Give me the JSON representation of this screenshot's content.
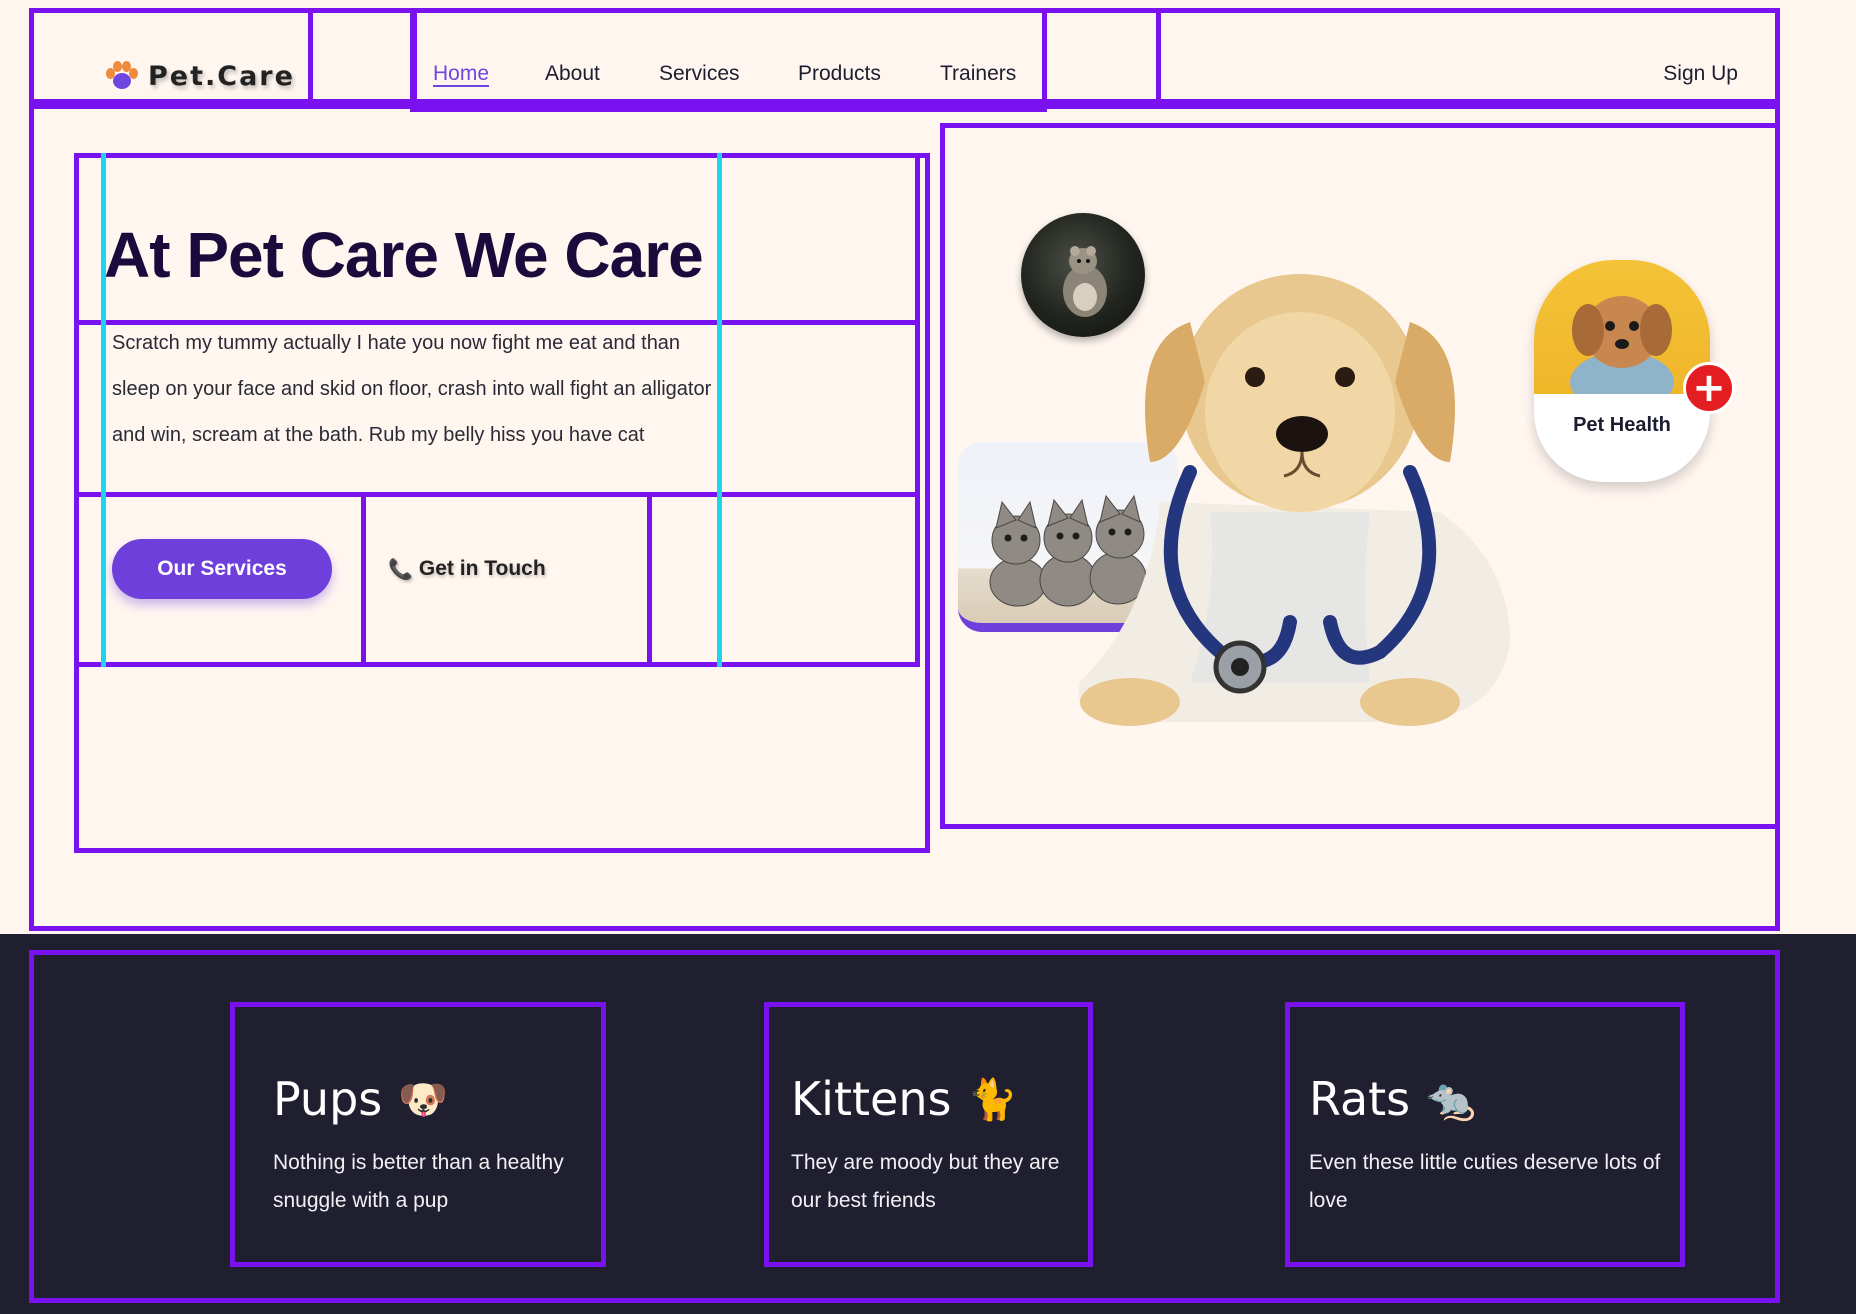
{
  "brand": {
    "name": "Pet.Care",
    "logo_icon": "paw-icon"
  },
  "nav": {
    "items": [
      {
        "label": "Home",
        "active": true
      },
      {
        "label": "About",
        "active": false
      },
      {
        "label": "Services",
        "active": false
      },
      {
        "label": "Products",
        "active": false
      },
      {
        "label": "Trainers",
        "active": false
      }
    ],
    "signup_label": "Sign Up"
  },
  "hero": {
    "title": "At Pet Care We Care",
    "text": "Scratch my tummy actually I hate you now fight me eat and than sleep on your face and skid on floor, crash into wall fight an alligator and win, scream at the bath. Rub my belly hiss you have cat",
    "primary_button": "Our Services",
    "contact_button": "Get in Touch",
    "contact_icon": "phone-icon"
  },
  "media": {
    "health_card_label": "Pet Health",
    "badge_icon": "plus-icon"
  },
  "features": [
    {
      "title": "Pups",
      "emoji": "🐶",
      "text": "Nothing is better than a healthy snuggle with a pup"
    },
    {
      "title": "Kittens",
      "emoji": "🐈",
      "text": "They are moody but they are our best friends"
    },
    {
      "title": "Rats",
      "emoji": "🐀",
      "text": "Even these little cuties deserve lots of love"
    }
  ],
  "colors": {
    "page_background": "#fff6f0",
    "accent": "#6f3fdc",
    "heading": "#1b0b3c",
    "dark_section": "#1f1f30",
    "debug_outline": "#7a12f0",
    "debug_guide": "#19d6f2",
    "badge": "#e41d22"
  }
}
